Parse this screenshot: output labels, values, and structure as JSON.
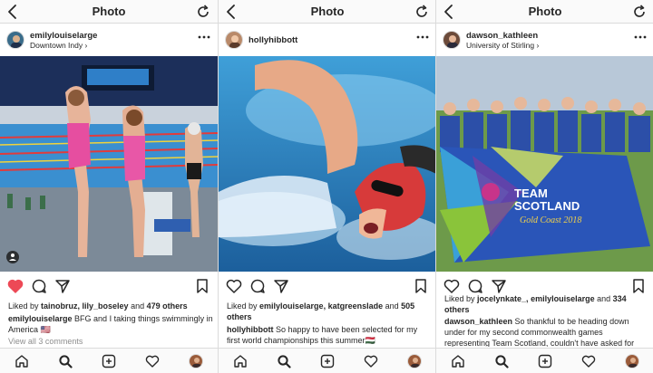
{
  "screen_title": "Photo",
  "posts": [
    {
      "username": "emilylouiselarge",
      "location": "Downtown Indy",
      "likes": {
        "prefix": "Liked by ",
        "users": "tainobruz, lily_boseley",
        "mid": " and ",
        "count": "479 others"
      },
      "caption": {
        "user": "emilylouiselarge",
        "text": " BFG and I taking things swimmingly in America 🇺🇸"
      },
      "view_comments": "View all 3 comments",
      "liked": true
    },
    {
      "username": "hollyhibbott",
      "location": "",
      "likes": {
        "prefix": "Liked by ",
        "users": "emilylouiselarge, katgreenslade",
        "mid": " and ",
        "count": "505 others"
      },
      "caption": {
        "user": "hollyhibbott",
        "text": " So happy to have been selected for my first world championships this summer🇭🇺"
      },
      "view_comments": "",
      "liked": false
    },
    {
      "username": "dawson_kathleen",
      "location": "University of Stirling",
      "likes": {
        "prefix": "Liked by ",
        "users": "jocelynkate_, emilylouiselarge",
        "mid": " and ",
        "count": "334 others"
      },
      "caption": {
        "user": "dawson_kathleen",
        "text": " So thankful to be heading down under for my second commonwealth games representing Team Scotland, couldn't have asked for"
      },
      "view_comments": "",
      "liked": false
    }
  ],
  "banner": {
    "line1": "TEAM",
    "line2": "SCOTLAND",
    "line3": "Gold Coast 2018"
  },
  "colors": {
    "like_red": "#ed4956",
    "text": "#262626",
    "muted": "#8e8e8e",
    "border": "#dbdbdb",
    "link_blue": "#003569"
  },
  "icons": {
    "top": [
      "back-chevron-icon",
      "refresh-icon"
    ],
    "post": [
      "more-options-icon",
      "heart-icon",
      "comment-icon",
      "share-icon",
      "bookmark-icon"
    ],
    "tabs": [
      "home-icon",
      "search-icon",
      "new-post-icon",
      "activity-heart-icon",
      "profile-avatar"
    ]
  }
}
